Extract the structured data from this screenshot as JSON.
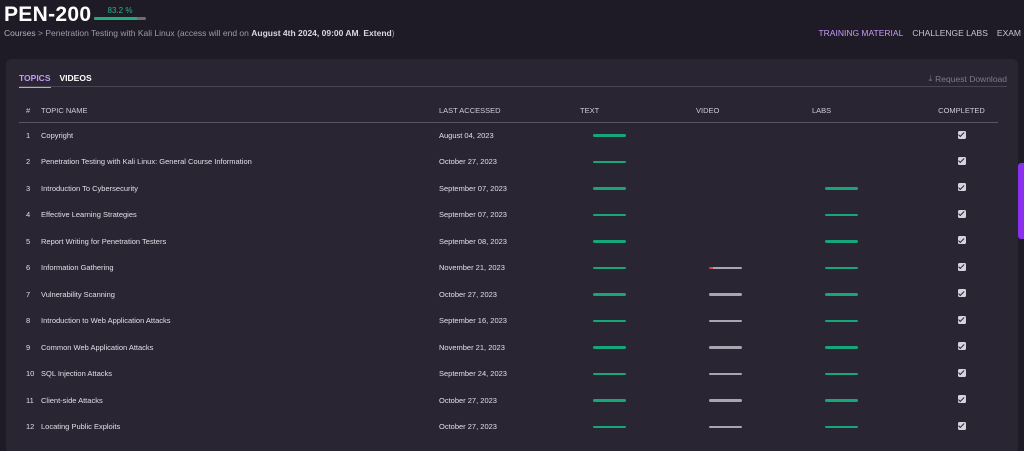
{
  "header": {
    "course_code": "PEN-200",
    "progress_label": "83.2 %",
    "progress_fraction": 0.832
  },
  "breadcrumb": {
    "root": "Courses",
    "separator": ">",
    "course_name": "Penetration Testing with Kali Linux",
    "access_prefix": "(access will end on",
    "access_date": "August 4th 2024, 09:00 AM",
    "access_mid": ".",
    "extend_label": "Extend",
    "access_suffix": ")"
  },
  "top_nav": [
    {
      "label": "TRAINING MATERIAL",
      "active": true
    },
    {
      "label": "CHALLENGE LABS",
      "active": false
    },
    {
      "label": "EXAM",
      "active": false
    }
  ],
  "tabs": [
    {
      "label": "TOPICS",
      "active": true
    },
    {
      "label": "VIDEOS",
      "active": false
    }
  ],
  "request_download": {
    "label": "Request Download",
    "icon": "download-icon"
  },
  "table": {
    "columns": [
      "#",
      "TOPIC NAME",
      "LAST ACCESSED",
      "TEXT",
      "VIDEO",
      "LABS",
      "COMPLETED"
    ],
    "rows": [
      {
        "num": "1",
        "name": "Copyright",
        "last_accessed": "August 04, 2023",
        "text": 1.0,
        "video": null,
        "labs": null,
        "completed": true
      },
      {
        "num": "2",
        "name": "Penetration Testing with Kali Linux: General Course Information",
        "last_accessed": "October 27, 2023",
        "text": 1.0,
        "video": null,
        "labs": null,
        "completed": true
      },
      {
        "num": "3",
        "name": "Introduction To Cybersecurity",
        "last_accessed": "September 07, 2023",
        "text": 1.0,
        "video": null,
        "labs": 1.0,
        "completed": true
      },
      {
        "num": "4",
        "name": "Effective Learning Strategies",
        "last_accessed": "September 07, 2023",
        "text": 1.0,
        "video": null,
        "labs": 1.0,
        "completed": true
      },
      {
        "num": "5",
        "name": "Report Writing for Penetration Testers",
        "last_accessed": "September 08, 2023",
        "text": 1.0,
        "video": null,
        "labs": 1.0,
        "completed": true
      },
      {
        "num": "6",
        "name": "Information Gathering",
        "last_accessed": "November 21, 2023",
        "text": 1.0,
        "video": 0.1,
        "labs": 1.0,
        "completed": true
      },
      {
        "num": "7",
        "name": "Vulnerability Scanning",
        "last_accessed": "October 27, 2023",
        "text": 1.0,
        "video": 0.0,
        "labs": 1.0,
        "completed": true
      },
      {
        "num": "8",
        "name": "Introduction to Web Application Attacks",
        "last_accessed": "September 16, 2023",
        "text": 1.0,
        "video": 0.0,
        "labs": 1.0,
        "completed": true
      },
      {
        "num": "9",
        "name": "Common Web Application Attacks",
        "last_accessed": "November 21, 2023",
        "text": 1.0,
        "video": 0.0,
        "labs": 1.0,
        "completed": true
      },
      {
        "num": "10",
        "name": "SQL Injection Attacks",
        "last_accessed": "September 24, 2023",
        "text": 1.0,
        "video": 0.0,
        "labs": 1.0,
        "completed": true
      },
      {
        "num": "11",
        "name": "Client-side Attacks",
        "last_accessed": "October 27, 2023",
        "text": 1.0,
        "video": 0.0,
        "labs": 1.0,
        "completed": true
      },
      {
        "num": "12",
        "name": "Locating Public Exploits",
        "last_accessed": "October 27, 2023",
        "text": 1.0,
        "video": 0.0,
        "labs": 1.0,
        "completed": true
      }
    ]
  },
  "colors": {
    "background": "#1f1b26",
    "panel": "#2a2532",
    "accent": "#c39bf6",
    "progress_green": "#15a77a",
    "video_started": "#d2465d"
  }
}
